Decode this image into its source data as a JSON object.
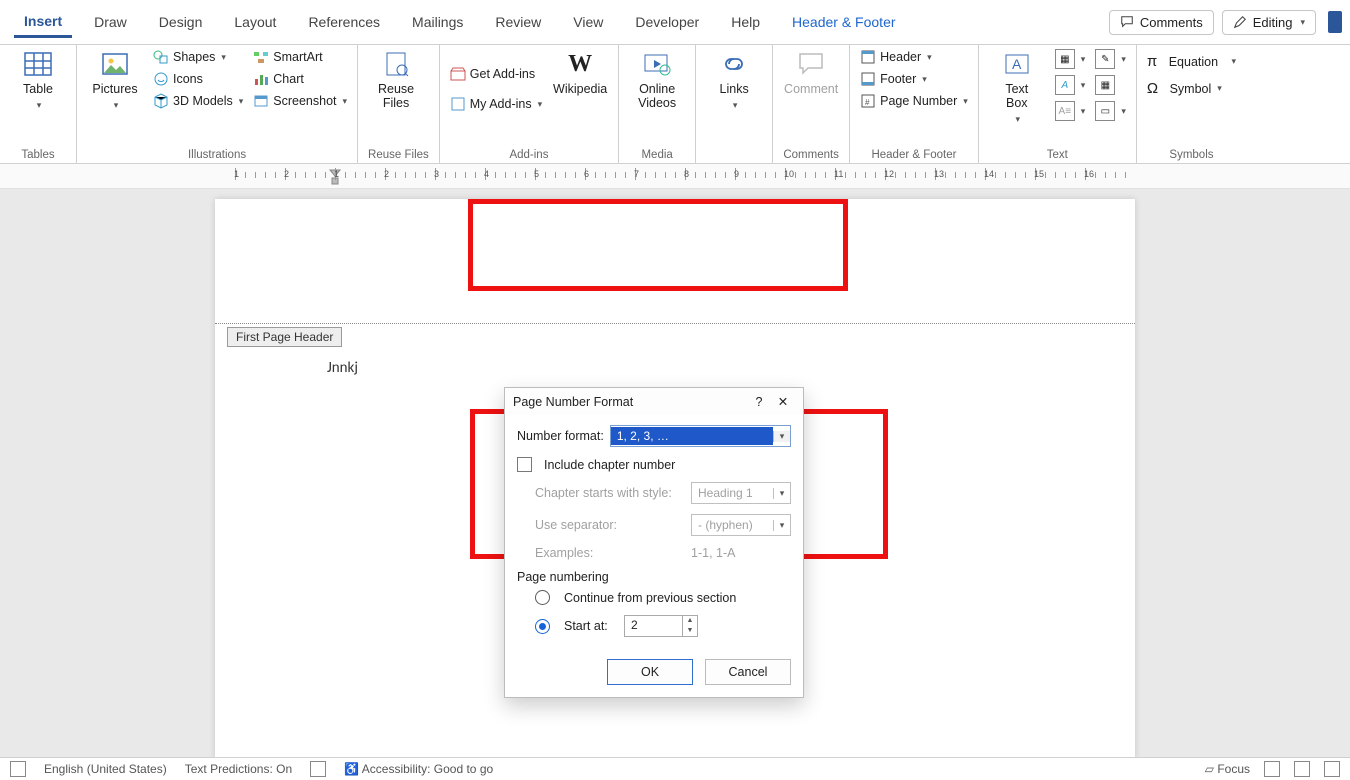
{
  "tabs": {
    "list": [
      "Insert",
      "Draw",
      "Design",
      "Layout",
      "References",
      "Mailings",
      "Review",
      "View",
      "Developer",
      "Help",
      "Header & Footer"
    ],
    "active": "Insert",
    "context": "Header & Footer",
    "comments": "Comments",
    "editing": "Editing"
  },
  "ribbon": {
    "tables": {
      "group_label": "Tables",
      "table": "Table"
    },
    "illustrations": {
      "group_label": "Illustrations",
      "pictures": "Pictures",
      "shapes": "Shapes",
      "icons": "Icons",
      "models": "3D Models",
      "smartart": "SmartArt",
      "chart": "Chart",
      "screenshot": "Screenshot"
    },
    "reuse": {
      "group_label": "Reuse Files",
      "btn": "Reuse\nFiles"
    },
    "addins": {
      "group_label": "Add-ins",
      "get": "Get Add-ins",
      "my": "My Add-ins",
      "wiki": "Wikipedia"
    },
    "media": {
      "group_label": "Media",
      "btn": "Online\nVideos"
    },
    "links": {
      "group_label": "",
      "btn": "Links"
    },
    "comments": {
      "group_label": "Comments",
      "btn": "Comment"
    },
    "headerfooter": {
      "group_label": "Header & Footer",
      "header": "Header",
      "footer": "Footer",
      "pagenum": "Page Number"
    },
    "text": {
      "group_label": "Text",
      "textbox": "Text\nBox"
    },
    "symbols": {
      "group_label": "Symbols",
      "eq": "Equation",
      "sym": "Symbol"
    }
  },
  "ruler": {
    "marks": [
      "1",
      "2",
      "1",
      "2",
      "3",
      "4",
      "5",
      "6",
      "7",
      "8",
      "9",
      "10",
      "11",
      "12",
      "13",
      "14",
      "15",
      "16"
    ]
  },
  "document": {
    "header_tag": "First Page Header",
    "body_text": "Jnnkj"
  },
  "dialog": {
    "title": "Page Number Format",
    "nf_label": "Number format:",
    "nf_value": "1, 2, 3, …",
    "include_chapter": "Include chapter number",
    "chap_style_label": "Chapter starts with style:",
    "chap_style_value": "Heading 1",
    "sep_label": "Use separator:",
    "sep_value": "-   (hyphen)",
    "examples_label": "Examples:",
    "examples_value": "1-1, 1-A",
    "pn_section": "Page numbering",
    "cont": "Continue from previous section",
    "start_label": "Start at:",
    "start_value": "2",
    "ok": "OK",
    "cancel": "Cancel"
  },
  "status": {
    "lang": "English (United States)",
    "pred_lbl": "Text Predictions:",
    "pred_val": "On",
    "acc": "Accessibility: Good to go",
    "focus": "Focus"
  }
}
